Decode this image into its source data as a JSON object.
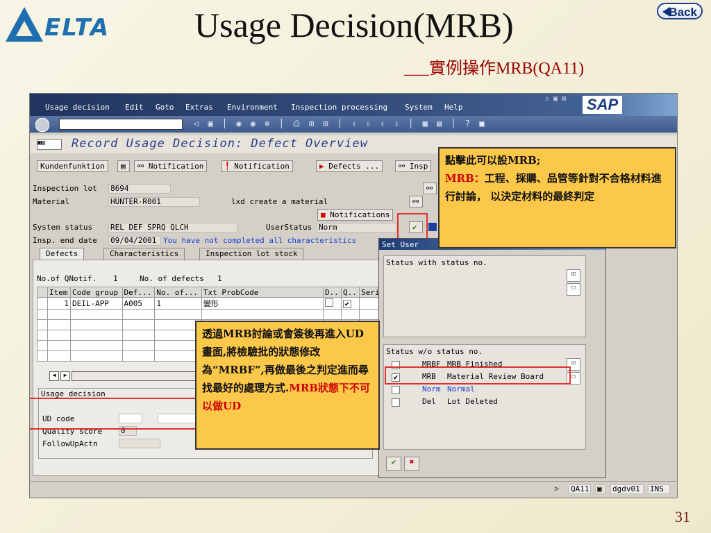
{
  "slide": {
    "logo_text": "ELTA",
    "title": "Usage Decision(MRB)",
    "subtitle": "___實例操作MRB(QA11)",
    "back_label": "Back",
    "page_number": "31"
  },
  "sap": {
    "menu": [
      "Usage decision",
      "Edit",
      "Goto",
      "Extras",
      "Environment",
      "Inspection processing",
      "System",
      "Help"
    ],
    "window_buttons": "▫ ▣ ⊠",
    "logo": "SAP",
    "screen_title": "Record Usage Decision: Defect Overview",
    "app_buttons": [
      "Kundenfunktion",
      "Notification",
      "Notification",
      "Defects ...",
      "Insp"
    ],
    "fields": {
      "inspection_lot_label": "Inspection lot",
      "inspection_lot": "8694",
      "material_label": "Material",
      "material": "HUNTER-R001",
      "material_desc": "lxd create a material",
      "notifications_btn": "Notifications",
      "system_status_label": "System status",
      "system_status": "REL  DEF  SPRQ QLCH",
      "user_status_label": "UserStatus",
      "user_status": "Norm",
      "insp_end_label": "Insp. end date",
      "insp_end": "09/04/2001",
      "insp_msg": "You have not completed all characteristics"
    },
    "tabs": [
      "Defects",
      "Characteristics",
      "Inspection lot stock"
    ],
    "defects_summary": {
      "notif_label": "No.of QNotif.",
      "notif_count": "1",
      "defects_label": "No. of defects",
      "defects_count": "1"
    },
    "table": {
      "headers": [
        "Item",
        "Code group",
        "Def...",
        "No. of...",
        "Txt ProbCode",
        "D..",
        "Q..",
        "Seri"
      ],
      "rows": [
        [
          "1",
          "DEIL-APP",
          "A005",
          "1",
          "變形",
          "",
          ""
        ]
      ]
    },
    "ud_group": {
      "title": "Usage decision",
      "ud_code": "UD code",
      "quality_score": "Quality score",
      "quality_value": "0",
      "followup": "FollowUpActn"
    },
    "statusbar": {
      "tcode": "QA11",
      "server": "dgdv01",
      "mode": "INS"
    },
    "popup": {
      "title": "Set User",
      "group1": "Status with status no.",
      "group2": "Status w/o status no.",
      "rows": [
        {
          "code": "MRBF",
          "text": "MRB Finished",
          "checked": false
        },
        {
          "code": "MRB",
          "text": "Material Review Board",
          "checked": true
        },
        {
          "code": "Norm",
          "text": "Normal",
          "checked": false
        },
        {
          "code": "Del",
          "text": "Lot Deleted",
          "checked": false
        }
      ],
      "ok": "✔",
      "cancel": "✖"
    }
  },
  "notes": {
    "top_line1": "點擊此可以設MRB;",
    "top_red": "MRB：",
    "top_line2": "工程、採購、品管等針對不合格材料進行討論， 以決定材料的最終判定",
    "bottom_main": "透過MRB討論或會簽後再進入UD畫面,將檢驗批的狀態修改為“MRBF”,再做最後之判定進而尋找最好的處理方式.",
    "bottom_red": "MRB狀態下不可以做UD"
  },
  "colors": {
    "accent_red": "#e03030",
    "note_bg": "#fcc84a",
    "title_blue": "#2b3d8a"
  }
}
